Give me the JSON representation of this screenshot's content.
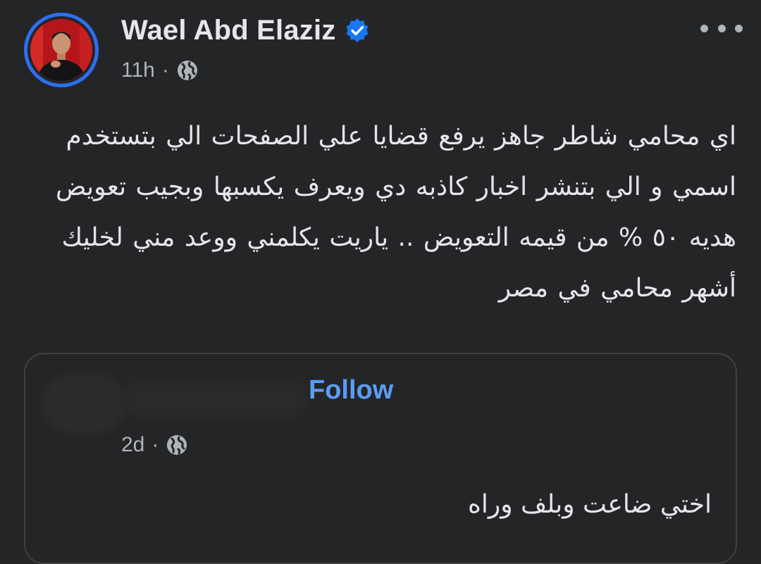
{
  "post": {
    "author_name": "Wael Abd Elaziz",
    "time": "11h",
    "separator": "·",
    "audience_icon": "globe-icon",
    "verified_icon": "verified-badge-icon",
    "more_icon": "more-options-icon",
    "text": "اي محامي شاطر جاهز يرفع قضايا علي الصفحات الي بتستخدم اسمي و الي بتنشر اخبار كاذبه دي ويعرف يكسبها وبجيب تعويض هديه ٥٠ % من قيمه التعويض .. ياريت يكلمني ووعد مني لخليك أشهر محامي في مصر"
  },
  "shared_post": {
    "follow_label": "Follow",
    "time": "2d",
    "separator": "·",
    "audience_icon": "globe-icon",
    "text": "اختي ضاعت وبلف وراه"
  },
  "colors": {
    "background": "#242526",
    "text": "#e4e6eb",
    "secondary_text": "#b0b3b8",
    "accent": "#5b9cf5",
    "avatar_ring": "#2d6ff0",
    "verified": "#1877f2"
  }
}
